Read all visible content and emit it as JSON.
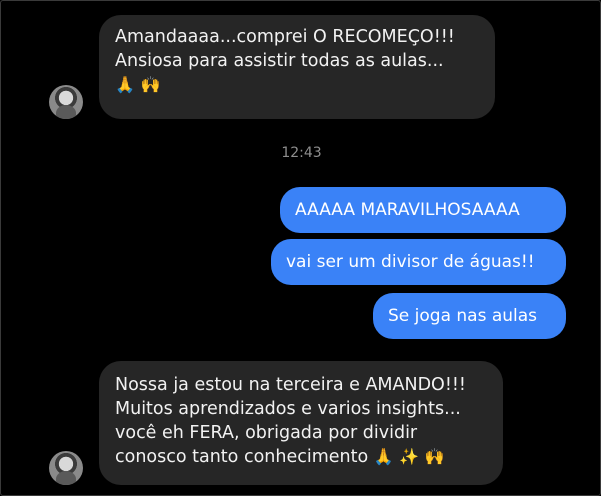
{
  "conversation": {
    "messages": [
      {
        "direction": "incoming",
        "lines": [
          "Amandaaaa...comprei O RECOMEÇO!!!",
          "Ansiosa para assistir todas as aulas..."
        ],
        "emojis": [
          "🙏",
          "🙌"
        ]
      },
      {
        "direction": "outgoing",
        "text": "AAAAA MARAVILHOSAAAA"
      },
      {
        "direction": "outgoing",
        "text": "vai ser um divisor de águas!!"
      },
      {
        "direction": "outgoing",
        "text": "Se joga nas aulas"
      },
      {
        "direction": "incoming",
        "lines": [
          "Nossa ja estou na terceira e AMANDO!!!",
          "Muitos aprendizados e varios insights...",
          "você eh FERA, obrigada por dividir",
          "conosco tanto conhecimento"
        ],
        "emojis": [
          "🙏",
          "✨",
          "🙌"
        ]
      }
    ],
    "timestamp": "12:43"
  },
  "colors": {
    "background": "#000000",
    "incoming_bubble": "#262626",
    "outgoing_bubble": "#3a82f7",
    "timestamp": "#8e8e8e"
  }
}
